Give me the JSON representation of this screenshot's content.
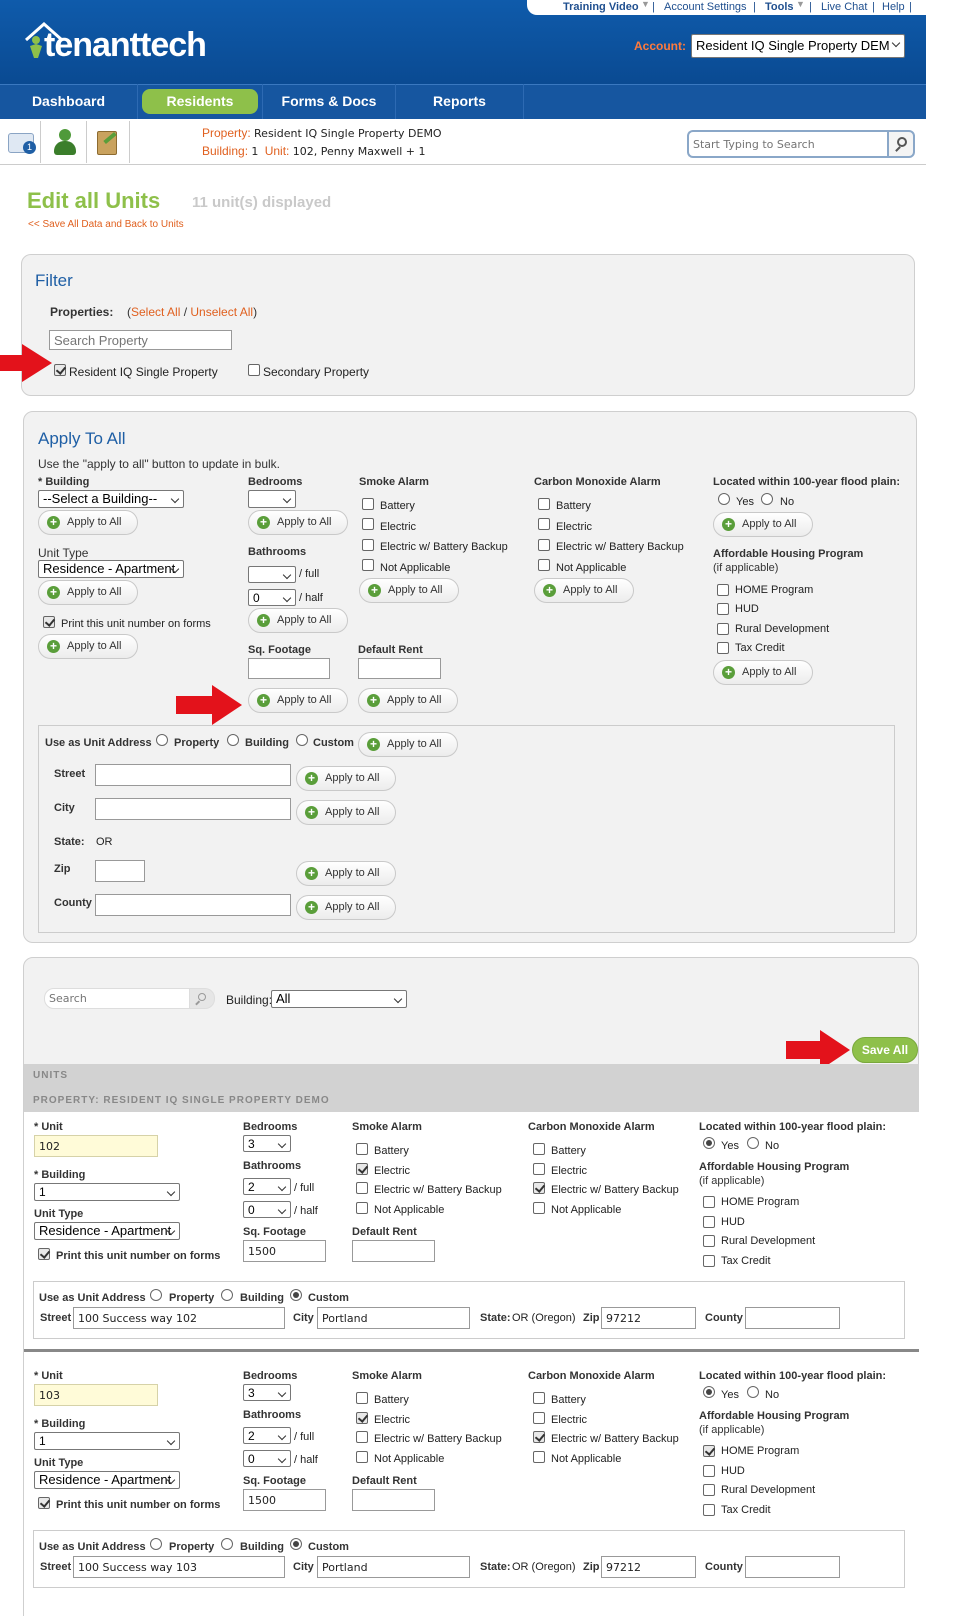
{
  "topnav": {
    "links": [
      "Training Video",
      "Account Settings",
      "Tools",
      "Live Chat",
      "Help"
    ],
    "separator": "|"
  },
  "brand": {
    "logo": "tenanttech",
    "account_label": "Account:",
    "account_value": "Resident IQ Single Property DEM"
  },
  "mainnav": {
    "tabs": [
      "Dashboard",
      "Residents",
      "Forms & Docs",
      "Reports"
    ],
    "active": "Residents"
  },
  "context": {
    "property_label": "Property:",
    "property_value": "Resident IQ Single Property DEMO",
    "building_label": "Building:",
    "building_value": "1",
    "unit_label": "Unit:",
    "unit_value": "102, Penny Maxwell + 1",
    "search_placeholder": "Start Typing to Search",
    "badge": "1"
  },
  "page": {
    "title": "Edit all Units",
    "count": "11 unit(s) displayed",
    "back_link": "<< Save All Data and Back to Units"
  },
  "filter": {
    "title": "Filter",
    "properties_label": "Properties:",
    "select_all": "Select All",
    "unselect_all": "Unselect All",
    "search_placeholder": "Search Property",
    "options": [
      {
        "label": "Resident IQ Single Property",
        "checked": true
      },
      {
        "label": "Secondary Property",
        "checked": false
      }
    ]
  },
  "apply": {
    "title": "Apply To All",
    "desc": "Use the \"apply to all\" button to update in bulk.",
    "apply_label": "Apply to All",
    "building_label": "* Building",
    "building_value": "--Select a Building--",
    "unit_type_label": "Unit Type",
    "unit_type_value": "Residence - Apartment",
    "print_label": "Print this unit number on forms",
    "bedrooms_label": "Bedrooms",
    "bathrooms_label": "Bathrooms",
    "full": "/ full",
    "half": "/ half",
    "half_value": "0",
    "sqft_label": "Sq. Footage",
    "rent_label": "Default Rent",
    "smoke_label": "Smoke Alarm",
    "co_label": "Carbon Monoxide Alarm",
    "alarm_options": [
      "Battery",
      "Electric",
      "Electric w/ Battery Backup",
      "Not Applicable"
    ],
    "flood_label": "Located within 100-year flood plain:",
    "yes": "Yes",
    "no": "No",
    "ahp_label": "Affordable Housing Program",
    "ahp_sub": "(if applicable)",
    "ahp_options": [
      "HOME Program",
      "HUD",
      "Rural Development",
      "Tax Credit"
    ],
    "addr_label": "Use as Unit Address",
    "addr_options": [
      "Property",
      "Building",
      "Custom"
    ],
    "street": "Street",
    "city": "City",
    "state": "State:",
    "state_value": "OR",
    "zip": "Zip",
    "county": "County"
  },
  "units_section": {
    "search_placeholder": "Search",
    "building_label": "Building:",
    "building_value": "All",
    "save_all": "Save All",
    "units_header": "UNITS",
    "property_header": "PROPERTY: RESIDENT IQ SINGLE PROPERTY DEMO"
  },
  "unit_labels": {
    "unit": "* Unit",
    "building": "* Building",
    "unit_type": "Unit Type",
    "print": "Print this unit number on forms",
    "bedrooms": "Bedrooms",
    "bathrooms": "Bathrooms",
    "full": "/ full",
    "half": "/ half",
    "sqft": "Sq. Footage",
    "rent": "Default Rent",
    "smoke": "Smoke Alarm",
    "co": "Carbon Monoxide Alarm",
    "flood": "Located within 100-year flood plain:",
    "ahp": "Affordable Housing Program",
    "ahp_sub": "(if applicable)",
    "addr": "Use as Unit Address",
    "street": "Street",
    "city": "City",
    "state": "State:",
    "zip": "Zip",
    "county": "County"
  },
  "units": [
    {
      "unit": "102",
      "building": "1",
      "unit_type": "Residence - Apartment",
      "print": true,
      "bedrooms": "3",
      "baths_full": "2",
      "baths_half": "0",
      "sqft": "1500",
      "rent": "",
      "smoke": [
        false,
        true,
        false,
        false
      ],
      "co": [
        false,
        false,
        true,
        false
      ],
      "flood": "Yes",
      "ahp": [
        false,
        false,
        false,
        false
      ],
      "addr_mode": "Custom",
      "street": "100 Success way 102",
      "city": "Portland",
      "state": "OR (Oregon)",
      "zip": "97212",
      "county": ""
    },
    {
      "unit": "103",
      "building": "1",
      "unit_type": "Residence - Apartment",
      "print": true,
      "bedrooms": "3",
      "baths_full": "2",
      "baths_half": "0",
      "sqft": "1500",
      "rent": "",
      "smoke": [
        false,
        true,
        false,
        false
      ],
      "co": [
        false,
        false,
        true,
        false
      ],
      "flood": "Yes",
      "ahp": [
        true,
        false,
        false,
        false
      ],
      "addr_mode": "Custom",
      "street": "100 Success way 103",
      "city": "Portland",
      "state": "OR (Oregon)",
      "zip": "97212",
      "county": ""
    }
  ],
  "colors": {
    "header_blue": "#0d4f9a",
    "nav_blue": "#1b5aa3",
    "active_green": "#8ec04a",
    "title_green": "#8ec04a",
    "link_orange": "#e0601f",
    "arrow_red": "#e3121b"
  }
}
